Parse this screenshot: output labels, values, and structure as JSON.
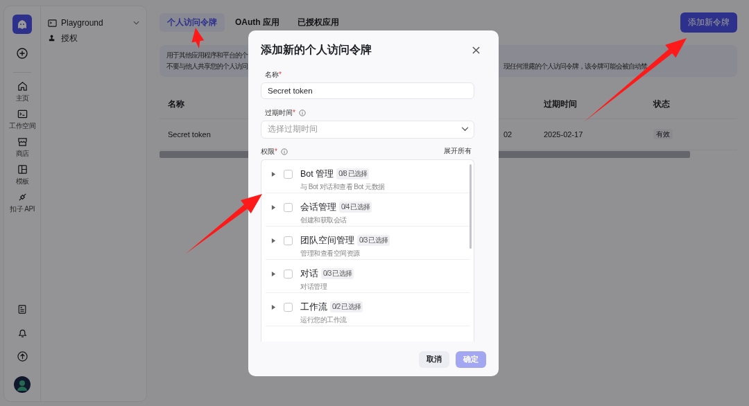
{
  "rail": {
    "items": [
      {
        "label": "主页"
      },
      {
        "label": "工作空间"
      },
      {
        "label": "商店"
      },
      {
        "label": "模板"
      },
      {
        "label": "扣子 API"
      }
    ]
  },
  "nav": {
    "items": [
      {
        "label": "Playground",
        "expandable": true
      },
      {
        "label": "授权",
        "expandable": false
      }
    ]
  },
  "tabs": [
    {
      "label": "个人访问令牌",
      "selected": true
    },
    {
      "label": "OAuth 应用",
      "selected": false
    },
    {
      "label": "已授权应用",
      "selected": false
    }
  ],
  "add_button": "添加新令牌",
  "notice": {
    "left_lines": [
      "用于其他应用程序和平台的个",
      "不要与他人共享您的个人访问"
    ],
    "right_text": "现任何泄露的个人访问令牌，该令牌可能会被自动禁"
  },
  "table": {
    "columns": [
      "名称",
      "",
      "过期时间",
      "状态"
    ],
    "rows": [
      {
        "name": "Secret token",
        "column_2": "02",
        "expires": "2025-02-17",
        "status": "有效"
      }
    ]
  },
  "dialog": {
    "title": "添加新的个人访问令牌",
    "name_field": {
      "label": "名称",
      "required_mark": "*",
      "value": "Secret token"
    },
    "expiry_field": {
      "label": "过期时间",
      "required_mark": "*",
      "placeholder": "选择过期时间"
    },
    "permissions": {
      "label": "权限",
      "required_mark": "*",
      "expand_all": "展开所有",
      "groups": [
        {
          "title": "Bot 管理",
          "count": "0/8 已选择",
          "description": "与 Bot 对话和查看 Bot 元数据",
          "checked": false,
          "expanded": false
        },
        {
          "title": "会话管理",
          "count": "0/4 已选择",
          "description": "创建和获取会话",
          "checked": false,
          "expanded": false
        },
        {
          "title": "团队空间管理",
          "count": "0/3 已选择",
          "description": "管理和查看空间资源",
          "checked": false,
          "expanded": false
        },
        {
          "title": "对话",
          "count": "0/3 已选择",
          "description": "对话管理",
          "checked": false,
          "expanded": false
        },
        {
          "title": "工作流",
          "count": "0/2 已选择",
          "description": "运行您的工作流",
          "checked": false,
          "expanded": false
        }
      ]
    },
    "buttons": [
      {
        "label": "取消",
        "kind": "secondary",
        "disabled": false
      },
      {
        "label": "确定",
        "kind": "primary",
        "disabled": true
      }
    ]
  }
}
